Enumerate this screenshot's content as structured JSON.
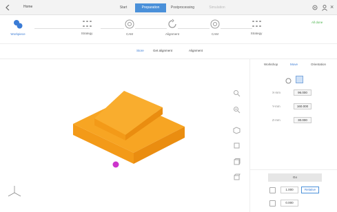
{
  "titlebar": {
    "home_label": "Home",
    "tabs": [
      {
        "label": "Start"
      },
      {
        "label": "Preparation"
      },
      {
        "label": "Postprocessing"
      },
      {
        "label": "Simulation"
      }
    ]
  },
  "stepper": {
    "steps": [
      {
        "label": "Workpiece",
        "icon": "workpiece-icon"
      },
      {
        "label": "Strategy",
        "icon": "strategy-icon"
      },
      {
        "label": "CAM",
        "icon": "cam-icon"
      },
      {
        "label": "Alignment",
        "icon": "alignment-icon"
      },
      {
        "label": "CAM",
        "icon": "cam-icon"
      },
      {
        "label": "Strategy",
        "icon": "strategy-icon"
      }
    ],
    "status": "All done"
  },
  "subtabs": {
    "items": [
      {
        "label": "Store"
      },
      {
        "label": "Get alignment"
      },
      {
        "label": "Alignment"
      }
    ]
  },
  "panel": {
    "tabs": [
      {
        "label": "Workshop"
      },
      {
        "label": "Move"
      },
      {
        "label": "Orientation"
      }
    ],
    "fields": [
      {
        "label": "X-mm",
        "value": "96.000"
      },
      {
        "label": "Y-mm",
        "value": "160.000"
      },
      {
        "label": "Z-mm",
        "value": "30.000"
      }
    ],
    "action_label": "Go",
    "value_1": "1.000",
    "value_1_alt": "Relative",
    "value_2": "0.000"
  },
  "colors": {
    "accent": "#4a90d9",
    "part": "#f5a21c",
    "origin_marker": "#cc33cc",
    "status_ok": "#49b34a"
  }
}
